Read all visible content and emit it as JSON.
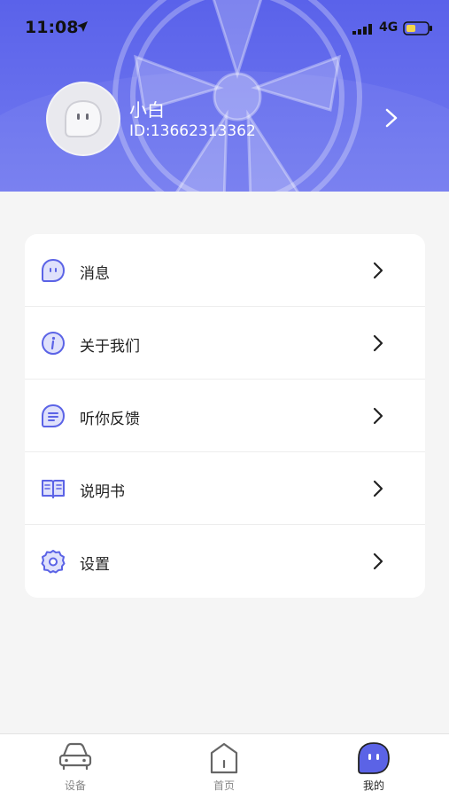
{
  "status_bar": {
    "time": "11:08",
    "network": "4G"
  },
  "profile": {
    "username": "小白",
    "id_text": "ID:13662313362"
  },
  "menu": {
    "items": [
      {
        "label": "消息",
        "icon": "message-icon"
      },
      {
        "label": "关于我们",
        "icon": "info-icon"
      },
      {
        "label": "听你反馈",
        "icon": "feedback-icon"
      },
      {
        "label": "说明书",
        "icon": "manual-book-icon"
      },
      {
        "label": "设置",
        "icon": "settings-gear-icon"
      }
    ]
  },
  "tabbar": {
    "tabs": [
      {
        "label": "设备",
        "icon": "car-icon"
      },
      {
        "label": "首页",
        "icon": "home-icon"
      },
      {
        "label": "我的",
        "icon": "profile-blob-icon",
        "active": true
      }
    ]
  },
  "colors": {
    "header_gradient_start": "#5a62ea",
    "header_gradient_end": "#727af0",
    "accent": "#5b63e6",
    "icon_fill": "#dfe1fb"
  }
}
